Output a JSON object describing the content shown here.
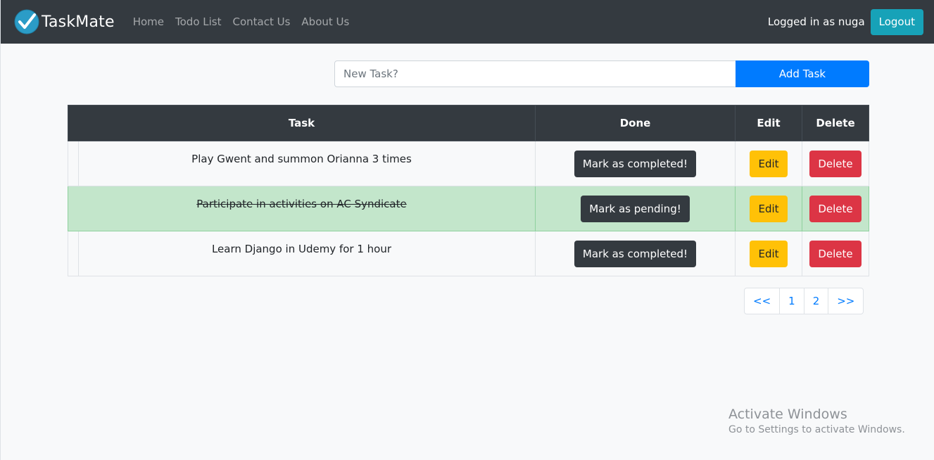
{
  "navbar": {
    "brand": "TaskMate",
    "links": [
      "Home",
      "Todo List",
      "Contact Us",
      "About Us"
    ],
    "logged_in_text": "Logged in as nuga",
    "logout_label": "Logout"
  },
  "form": {
    "placeholder": "New Task?",
    "value": "",
    "add_label": "Add Task"
  },
  "table": {
    "headers": [
      "Task",
      "Done",
      "Edit",
      "Delete"
    ],
    "rows": [
      {
        "task": "Play Gwent and summon Orianna 3 times",
        "done": false,
        "done_label": "Mark as completed!",
        "edit_label": "Edit",
        "delete_label": "Delete"
      },
      {
        "task": "Participate in activities on AC Syndicate",
        "done": true,
        "done_label": "Mark as pending!",
        "edit_label": "Edit",
        "delete_label": "Delete"
      },
      {
        "task": "Learn Django in Udemy for 1 hour",
        "done": false,
        "done_label": "Mark as completed!",
        "edit_label": "Edit",
        "delete_label": "Delete"
      }
    ]
  },
  "pagination": [
    "<<",
    "1",
    "2",
    ">>"
  ],
  "watermark": {
    "title": "Activate Windows",
    "subtitle": "Go to Settings to activate Windows."
  },
  "colors": {
    "navbar": "#343a40",
    "primary": "#007bff",
    "info": "#17a2b8",
    "warning": "#ffc107",
    "danger": "#dc3545",
    "success_row": "#c3e6cb"
  },
  "icons": {
    "brand": "checkmark-circle-icon"
  }
}
